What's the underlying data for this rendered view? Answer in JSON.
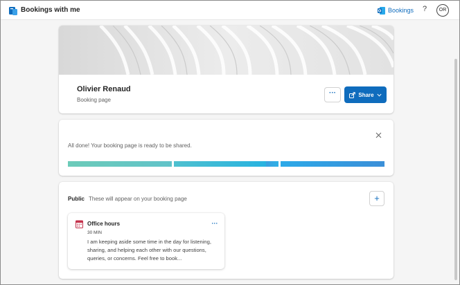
{
  "app": {
    "title": "Bookings with me",
    "icon": "bookings-icon"
  },
  "header": {
    "bookings_link": "Bookings",
    "bookings_icon": "outlook-icon",
    "help_label": "?",
    "avatar_initials": "OR"
  },
  "profile": {
    "name": "Olivier Renaud",
    "subtitle": "Booking page",
    "more_label": "···",
    "share_label": "Share"
  },
  "status": {
    "message": "All done! Your booking page is ready to be shared.",
    "close_label": "✕"
  },
  "services_section": {
    "title": "Public",
    "subtitle": "These will appear on your booking page",
    "add_label": "+",
    "services": [
      {
        "name": "Office hours",
        "duration": "30 MIN",
        "description": "I am keeping aside some time in the day for listening, sharing, and helping each other with our questions, queries, or concerns. Feel free to book...",
        "more_label": "···",
        "icon": "calendar-icon"
      }
    ]
  },
  "colors": {
    "accent": "#0f6cbd",
    "progress": [
      "#6ccbb9",
      "#28b3e0",
      "#3b8fd8"
    ]
  }
}
